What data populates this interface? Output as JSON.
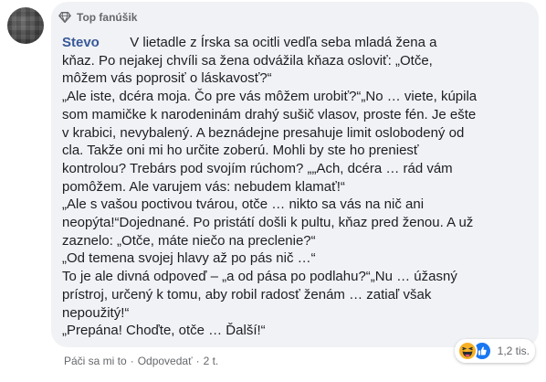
{
  "comment": {
    "badge": "Top fanúšik",
    "author": "Stevo",
    "lines": [
      "V lietadle z Írska sa ocitli vedľa seba mladá žena a",
      "kňaz. Po nejakej chvíli sa žena odvážila kňaza osloviť: „Otče,",
      "môžem vás poprosiť o láskavosť?“",
      "„Ale iste, dcéra moja. Čo pre vás môžem urobiť?“„No … viete, kúpila",
      "som mamičke k narodeninám drahý sušič vlasov, proste fén. Je ešte",
      "v krabici, nevybalený. A beznádejne presahuje limit oslobodený od",
      "cla. Takže oni mi ho určite zoberú. Mohli by ste ho preniesť",
      "kontrolou? Trebárs pod svojím rúchom? „„Ach, dcéra … rád vám",
      "pomôžem. Ale varujem vás: nebudem klamať!“",
      "„Ale s vašou poctivou tvárou, otče … nikto sa vás na nič ani",
      "neopýta!“Dojednané. Po pristátí došli k pultu, kňaz pred ženou. A už",
      "zaznelo: „Otče, máte niečo na preclenie?“",
      "„Od temena svojej hlavy až po pás nič …“",
      "To je ale divná odpoveď – „a od pása po podlahu?“„Nu … úžasný",
      "prístroj, určený k tomu, aby robil radosť ženám … zatiaľ však",
      "nepoužitý!“",
      "„Prepána! Choďte, otče … Ďalší!“"
    ],
    "actions": {
      "like": "Páči sa mi to",
      "reply": "Odpovedať",
      "separator": "·",
      "time": "2 t."
    },
    "reactions": {
      "count": "1,2 tis.",
      "icons": [
        "haha-reaction-icon",
        "like-reaction-icon"
      ]
    }
  }
}
